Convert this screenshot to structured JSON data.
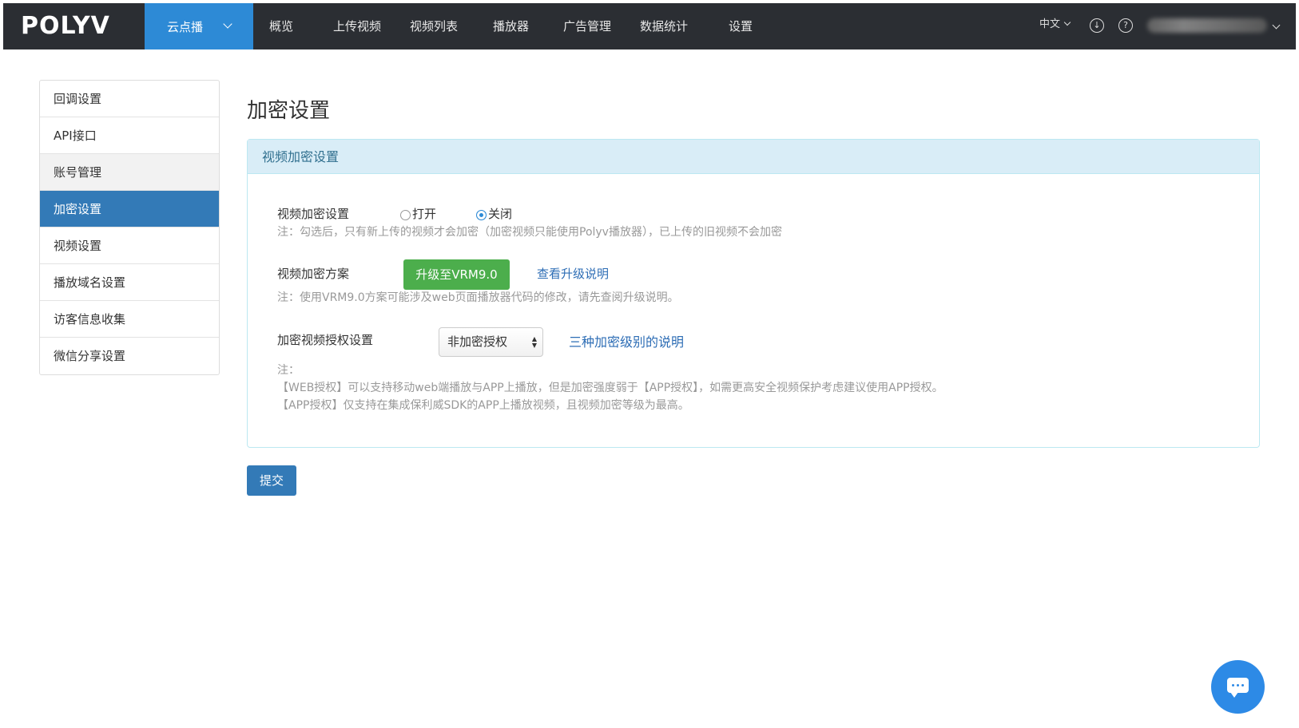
{
  "header": {
    "logo": "POLYV",
    "product": "云点播",
    "nav": [
      "概览",
      "上传视频",
      "视频列表",
      "播放器",
      "广告管理",
      "数据统计",
      "设置"
    ],
    "language": "中文",
    "download_icon": "download-icon",
    "help_icon": "help-icon"
  },
  "sidebar": {
    "items": [
      {
        "label": "回调设置"
      },
      {
        "label": "API接口"
      },
      {
        "label": "账号管理"
      },
      {
        "label": "加密设置"
      },
      {
        "label": "视频设置"
      },
      {
        "label": "播放域名设置"
      },
      {
        "label": "访客信息收集"
      },
      {
        "label": "微信分享设置"
      }
    ],
    "active_index": 3
  },
  "main": {
    "title": "加密设置",
    "panel": {
      "heading": "视频加密设置",
      "encryption": {
        "label": "视频加密设置",
        "option_on": "打开",
        "option_off": "关闭",
        "selected": "关闭",
        "note": "注：勾选后，只有新上传的视频才会加密（加密视频只能使用Polyv播放器），已上传的旧视频不会加密"
      },
      "scheme": {
        "label": "视频加密方案",
        "upgrade_button": "升级至VRM9.0",
        "upgrade_link": "查看升级说明",
        "note": "注：使用VRM9.0方案可能涉及web页面播放器代码的修改，请先查阅升级说明。"
      },
      "authorization": {
        "label": "加密视频授权设置",
        "selected": "非加密授权",
        "link": "三种加密级别的说明",
        "note_title": "注：",
        "note_web": "【WEB授权】可以支持移动web端播放与APP上播放，但是加密强度弱于【APP授权】，如需更高安全视频保护考虑建议使用APP授权。",
        "note_app": "【APP授权】仅支持在集成保利威SDK的APP上播放视频，且视频加密等级为最高。"
      }
    },
    "submit_label": "提交"
  },
  "chat_icon": "chat-bubble-icon",
  "colors": {
    "topbar": "#2b2e33",
    "product_tab": "#2d8ad6",
    "sidebar_active": "#337ab7",
    "panel_header": "#d9edf7",
    "upgrade_button": "#4cae4c",
    "link": "#2d6db5"
  }
}
